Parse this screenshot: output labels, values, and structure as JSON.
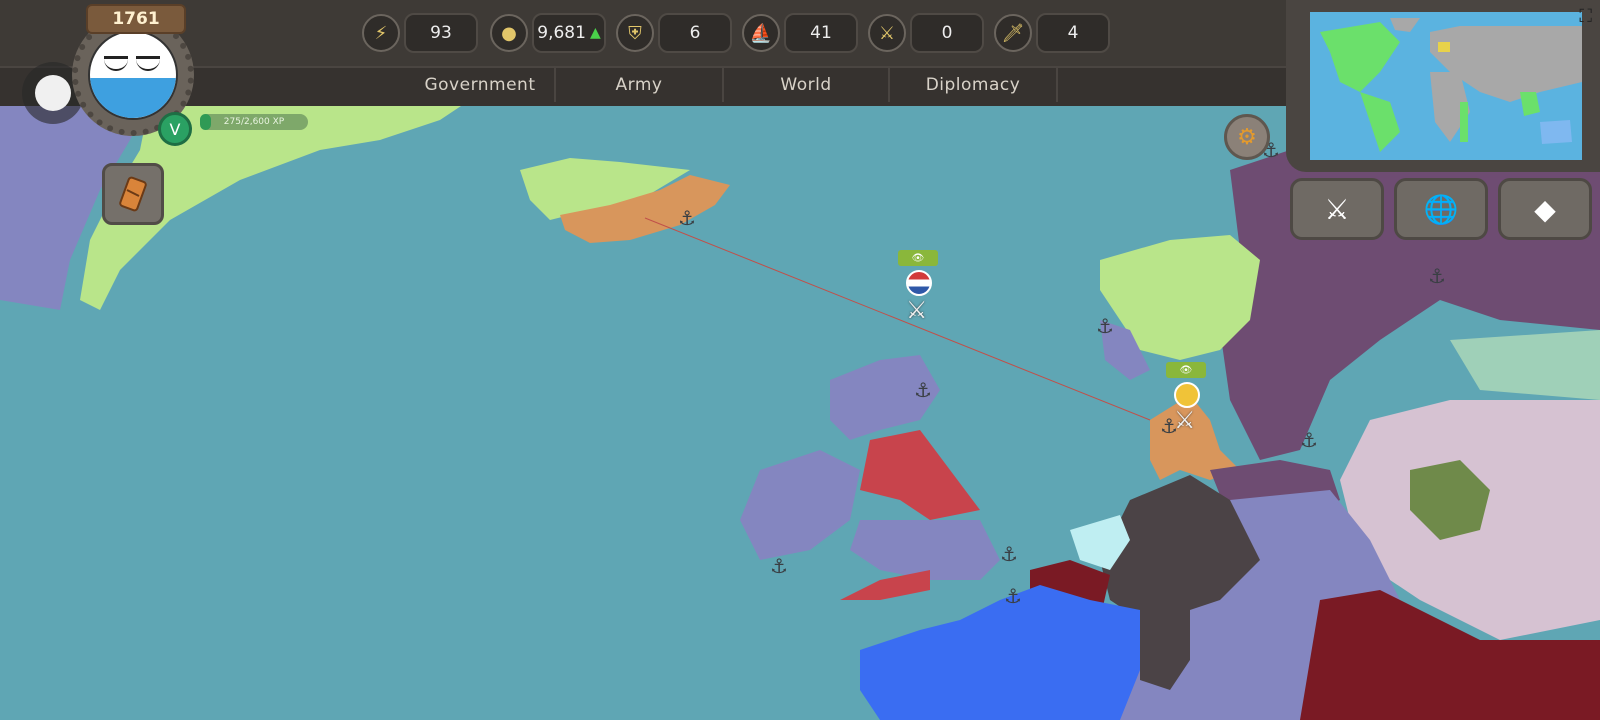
{
  "header": {
    "year": "1761",
    "level": "V",
    "xp": "275/2,600 XP",
    "xp_progress": 0.106
  },
  "resources": [
    {
      "name": "lightning-icon",
      "glyph": "⚡",
      "value": "93"
    },
    {
      "name": "gold-coins-icon",
      "glyph": "●",
      "value": "9,681",
      "trend": "▲"
    },
    {
      "name": "helmet-icon",
      "glyph": "⛨",
      "value": "6"
    },
    {
      "name": "ship-sail-icon",
      "glyph": "⛵",
      "value": "41"
    },
    {
      "name": "crossed-swords-icon",
      "glyph": "⚔",
      "value": "0"
    },
    {
      "name": "sword-icon",
      "glyph": "🗡",
      "value": "4"
    }
  ],
  "tabs": [
    "Government",
    "Army",
    "World",
    "Diplomacy"
  ],
  "colors": {
    "ocean": "#5fa6b4",
    "player_territory": "#d8965c",
    "greenland": "#b9e58a",
    "uk_red": "#c8444c",
    "france_blue": "#3a6df2",
    "dark_region": "#4b4346",
    "purple_region": "#6e4c72",
    "lavender_region": "#8486c0"
  },
  "side_buttons": [
    {
      "name": "sword-button",
      "glyph": "⚔"
    },
    {
      "name": "globe-button",
      "glyph": "🌐"
    },
    {
      "name": "diamond-button",
      "glyph": "◆"
    }
  ],
  "badges": [
    "👁",
    "👁"
  ]
}
